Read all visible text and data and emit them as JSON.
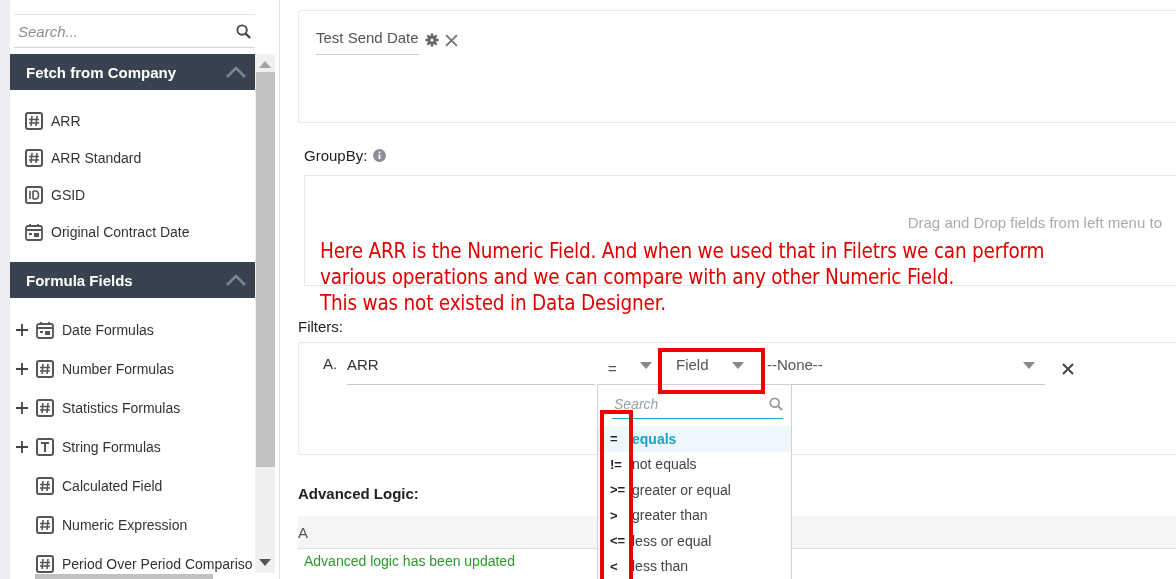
{
  "sidebar": {
    "search": {
      "placeholder": "Search..."
    },
    "sections": [
      {
        "title": "Fetch from Company",
        "expanded": true,
        "items": [
          {
            "label": "ARR",
            "kind": "number",
            "expandable": false
          },
          {
            "label": "ARR Standard",
            "kind": "number",
            "expandable": false
          },
          {
            "label": "GSID",
            "kind": "id",
            "expandable": false
          },
          {
            "label": "Original Contract Date",
            "kind": "date",
            "expandable": false
          }
        ]
      },
      {
        "title": "Formula Fields",
        "expanded": true,
        "items": [
          {
            "label": "Date Formulas",
            "kind": "date",
            "expandable": true
          },
          {
            "label": "Number Formulas",
            "kind": "number",
            "expandable": true
          },
          {
            "label": "Statistics Formulas",
            "kind": "number",
            "expandable": true
          },
          {
            "label": "String Formulas",
            "kind": "text",
            "expandable": true
          },
          {
            "label": "Calculated Field",
            "kind": "number",
            "expandable": false
          },
          {
            "label": "Numeric Expression",
            "kind": "number",
            "expandable": false
          },
          {
            "label": "Period Over Period Compariso",
            "kind": "number",
            "expandable": false
          }
        ]
      }
    ]
  },
  "columns_box": {
    "chips": [
      {
        "label": "Test Send Date"
      }
    ]
  },
  "group_by": {
    "label": "GroupBy:",
    "hint": "Drag and Drop fields from left menu to"
  },
  "filters": {
    "label": "Filters:",
    "rows": [
      {
        "letter": "A.",
        "field": "ARR",
        "operator": "=",
        "compare_type": "Field",
        "value": "--None--"
      }
    ],
    "operator_menu": {
      "placeholder": "Search",
      "options": [
        {
          "symbol": "=",
          "label": "equals",
          "selected": true
        },
        {
          "symbol": "!=",
          "label": "not equals",
          "selected": false
        },
        {
          "symbol": ">=",
          "label": "greater or equal",
          "selected": false
        },
        {
          "symbol": ">",
          "label": "greater than",
          "selected": false
        },
        {
          "symbol": "<=",
          "label": "less or equal",
          "selected": false
        },
        {
          "symbol": "<",
          "label": "less than",
          "selected": false
        }
      ]
    }
  },
  "advanced_logic": {
    "label": "Advanced Logic:",
    "expression": "A",
    "status": "Advanced logic has been updated"
  },
  "annotation": {
    "lines": [
      "Here ARR is the Numeric Field. And when we used that in Filetrs we can perform",
      "various operations and we can compare with any other Numeric Field.",
      "This was not existed in Data Designer."
    ]
  }
}
